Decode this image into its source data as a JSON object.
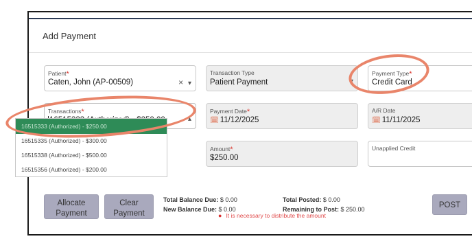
{
  "dialog": {
    "title": "Add Payment"
  },
  "patient": {
    "label": "Patient",
    "required_mark": "*",
    "value": "Caten, John (AP-00509)",
    "clear_icon": "×",
    "chevron": "▾"
  },
  "transaction_type": {
    "label": "Transaction Type",
    "value": "Patient Payment",
    "chevron": "▾"
  },
  "payment_type": {
    "label": "Payment Type",
    "required_mark": "*",
    "value": "Credit Card"
  },
  "transactions": {
    "label": "Transactions",
    "required_mark": "*",
    "value": "16515333 (Authorized) - $250.00",
    "chevron": "▴",
    "options": [
      {
        "text": "16515333 (Authorized) - $250.00",
        "selected": true
      },
      {
        "text": "16515335 (Authorized) - $300.00",
        "selected": false
      },
      {
        "text": "16515338 (Authorized) - $500.00",
        "selected": false
      },
      {
        "text": "16515356 (Authorized) - $200.00",
        "selected": false
      }
    ]
  },
  "payment_date": {
    "label": "Payment Date",
    "required_mark": "*",
    "value": "11/12/2025"
  },
  "ar_date": {
    "label": "A/R Date",
    "value": "11/11/2025"
  },
  "amount": {
    "label": "Amount",
    "required_mark": "*",
    "value": "$250.00"
  },
  "unapplied_credit": {
    "label": "Unapplied Credit",
    "value": ""
  },
  "buttons": {
    "allocate": "Allocate Payment",
    "clear": "Clear Payment",
    "post": "POST"
  },
  "summary": {
    "total_balance_due_label": "Total Balance Due:",
    "total_balance_due": "$ 0.00",
    "new_balance_due_label": "New Balance Due:",
    "new_balance_due": "$ 0.00",
    "total_posted_label": "Total Posted:",
    "total_posted": "$ 0.00",
    "remaining_label": "Remaining to Post:",
    "remaining": "$ 250.00"
  },
  "warning": "It is necessary to distribute the amount",
  "colors": {
    "annotation": "#e9856a",
    "selected_option": "#2e8b57",
    "button": "#a9a9bd",
    "required": "#d9342b"
  }
}
